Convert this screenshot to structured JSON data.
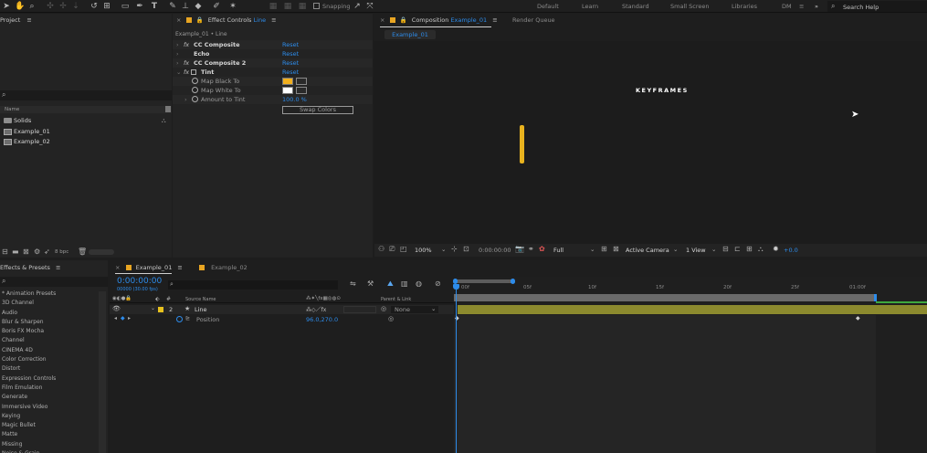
{
  "colors": {
    "accent": "#2d8ceb",
    "keyframe_yellow": "#e8b21e",
    "track_olive": "#8c8a2e",
    "label_yellow": "#e8a522"
  },
  "workspaces": [
    "Default",
    "Learn",
    "Standard",
    "Small Screen",
    "Libraries",
    "DM"
  ],
  "toolbar": {
    "snapping": "Snapping",
    "search_help": "Search Help"
  },
  "project": {
    "title": "Project",
    "col_name": "Name",
    "items": [
      {
        "name": "Solids",
        "icon": "folder-icon"
      },
      {
        "name": "Example_01",
        "icon": "composition-icon"
      },
      {
        "name": "Example_02",
        "icon": "composition-icon"
      }
    ],
    "bpc": "8 bpc"
  },
  "effect_controls": {
    "title": "Effect Controls",
    "layer_name": "Line",
    "breadcrumb": "Example_01 • Line",
    "effects": [
      {
        "name": "CC Composite",
        "reset": "Reset",
        "fx": "fx"
      },
      {
        "name": "Echo",
        "reset": "Reset",
        "fx": ""
      },
      {
        "name": "CC Composite 2",
        "reset": "Reset",
        "fx": "fx"
      },
      {
        "name": "Tint",
        "reset": "Reset",
        "fx": "fx"
      }
    ],
    "tint_props": [
      {
        "name": "Map Black To"
      },
      {
        "name": "Map White To"
      },
      {
        "name": "Amount to Tint",
        "value": "100.0 %"
      }
    ],
    "swap_colors": "Swap Colors"
  },
  "composition": {
    "title": "Composition",
    "comp_name": "Example_01",
    "render_queue": "Render Queue",
    "tab": "Example_01",
    "canvas_text": "KEYFRAMES",
    "zoom": "100%",
    "timecode": "0:00:00:00",
    "resolution": "Full",
    "camera": "Active Camera",
    "view": "1 View",
    "exposure": "+0.0"
  },
  "effects_presets": {
    "title": "Effects & Presets",
    "items": [
      "* Animation Presets",
      "3D Channel",
      "Audio",
      "Blur & Sharpen",
      "Boris FX Mocha",
      "Channel",
      "CINEMA 4D",
      "Color Correction",
      "Distort",
      "Expression Controls",
      "Film Emulation",
      "Generate",
      "Immersive Video",
      "Keying",
      "Magic Bullet",
      "Matte",
      "Missing",
      "Noise & Grain"
    ]
  },
  "timeline": {
    "tabs": [
      "Example_01",
      "Example_02"
    ],
    "timecode": "0:00:00:00",
    "fps": "00000 (30.00 fps)",
    "col_source": "Source Name",
    "col_parent": "Parent & Link",
    "layer": {
      "num": "2",
      "name": "Line",
      "parent": "None"
    },
    "property": {
      "name": "Position",
      "value": "96.0,270.0"
    },
    "ticks": [
      "00f",
      "05f",
      "10f",
      "15f",
      "20f",
      "25f",
      "01:00f"
    ]
  }
}
